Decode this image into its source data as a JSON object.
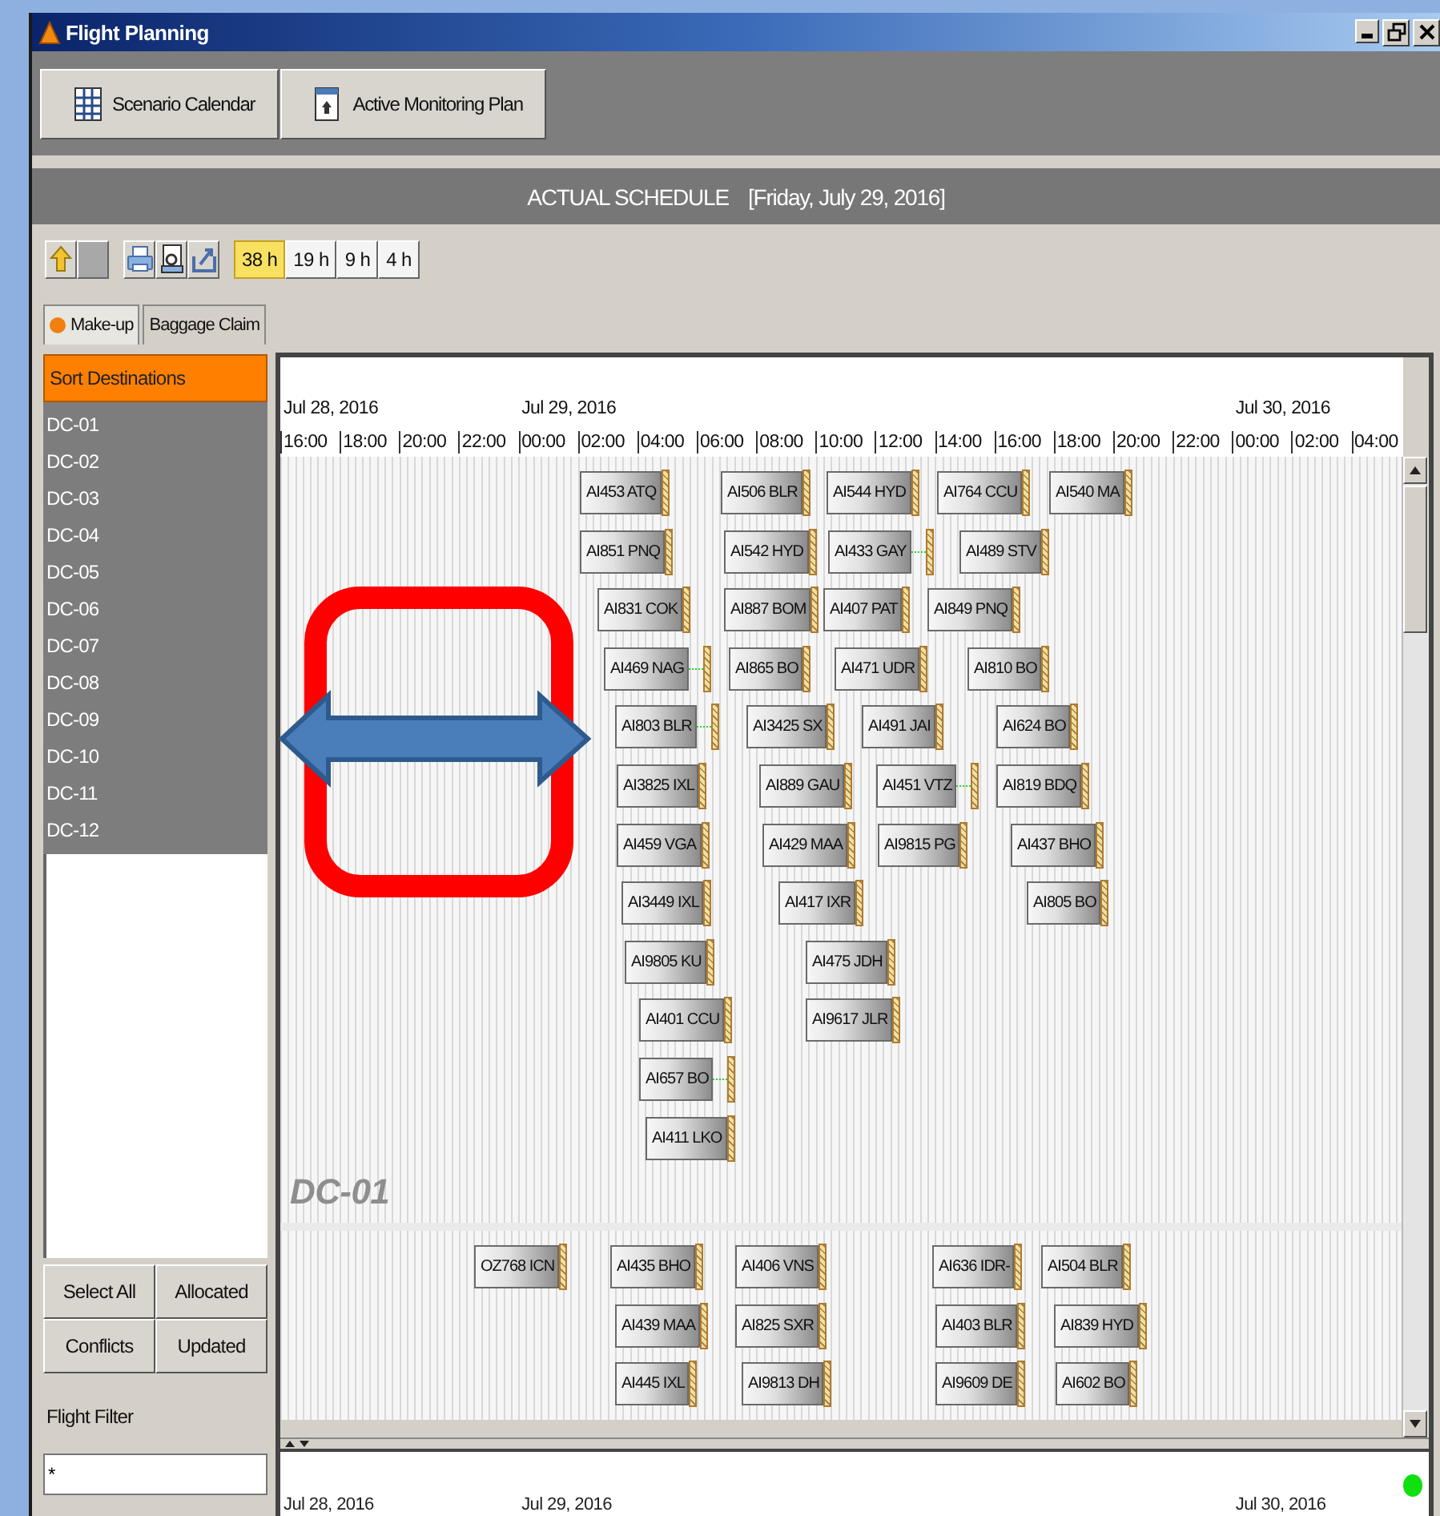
{
  "window": {
    "title": "Flight Planning"
  },
  "toolbar": [
    {
      "label": "Scenario Calendar",
      "kind": "calendar"
    },
    {
      "label": "Active Monitoring Plan",
      "kind": "plan"
    }
  ],
  "schedule": {
    "title": "ACTUAL SCHEDULE",
    "date": "[Friday, July 29, 2016]"
  },
  "tools": [
    {
      "kind": "up",
      "disabled": false
    },
    {
      "kind": "blank",
      "disabled": true
    },
    {
      "kind": "print",
      "disabled": false
    },
    {
      "kind": "preview",
      "disabled": false
    },
    {
      "kind": "export",
      "disabled": false
    }
  ],
  "zoom_buttons": [
    {
      "label": "38 h",
      "selected": true
    },
    {
      "label": "19 h",
      "selected": false
    },
    {
      "label": "9 h",
      "selected": false
    },
    {
      "label": "4 h",
      "selected": false
    }
  ],
  "side_tabs": [
    {
      "label": "Make-up",
      "selected": true
    },
    {
      "label": "Baggage Claim",
      "selected": false
    }
  ],
  "sort_destinations": {
    "title": "Sort Destinations",
    "items": [
      "DC-01",
      "DC-02",
      "DC-03",
      "DC-04",
      "DC-05",
      "DC-06",
      "DC-07",
      "DC-08",
      "DC-09",
      "DC-10",
      "DC-11",
      "DC-12"
    ]
  },
  "filter_buttons": [
    "Select All",
    "Allocated",
    "Conflicts",
    "Updated"
  ],
  "flight_filter": {
    "label": "Flight Filter",
    "value": "*"
  },
  "timeline": {
    "dates": [
      "Jul 28, 2016",
      "Jul 29, 2016",
      "Jul 30, 2016"
    ],
    "hours": [
      "16:00",
      "18:00",
      "20:00",
      "22:00",
      "00:00",
      "02:00",
      "04:00",
      "06:00",
      "08:00",
      "10:00",
      "12:00",
      "14:00",
      "16:00",
      "18:00",
      "20:00",
      "22:00",
      "00:00",
      "02:00",
      "04:00"
    ]
  },
  "sections": [
    {
      "label": "DC-01",
      "flights": [
        {
          "flight": "AI453 ATQ",
          "linked": false
        },
        {
          "flight": "AI506 BLR",
          "linked": false
        },
        {
          "flight": "AI544 HYD",
          "linked": false
        },
        {
          "flight": "AI764 CCU",
          "linked": false
        },
        {
          "flight": "AI540 MA",
          "linked": false
        },
        {
          "flight": "AI851 PNQ",
          "linked": false
        },
        {
          "flight": "AI542 HYD",
          "linked": false
        },
        {
          "flight": "AI433 GAY",
          "linked": true
        },
        {
          "flight": "AI489 STV",
          "linked": false
        },
        {
          "flight": "AI831 COK",
          "linked": false
        },
        {
          "flight": "AI887 BOM",
          "linked": false
        },
        {
          "flight": "AI407 PAT",
          "linked": false
        },
        {
          "flight": "AI849 PNQ",
          "linked": false
        },
        {
          "flight": "AI469 NAG",
          "linked": true
        },
        {
          "flight": "AI865 BO",
          "linked": false
        },
        {
          "flight": "AI471 UDR",
          "linked": false
        },
        {
          "flight": "AI810 BO",
          "linked": false
        },
        {
          "flight": "AI803 BLR",
          "linked": true
        },
        {
          "flight": "AI3425 SX",
          "linked": false
        },
        {
          "flight": "AI491 JAI",
          "linked": false
        },
        {
          "flight": "AI624 BO",
          "linked": false
        },
        {
          "flight": "AI3825 IXL",
          "linked": false
        },
        {
          "flight": "AI889 GAU",
          "linked": false
        },
        {
          "flight": "AI451 VTZ",
          "linked": true
        },
        {
          "flight": "AI819 BDQ",
          "linked": false
        },
        {
          "flight": "AI459 VGA",
          "linked": false
        },
        {
          "flight": "AI429 MAA",
          "linked": false
        },
        {
          "flight": "AI9815 PG",
          "linked": false
        },
        {
          "flight": "AI437 BHO",
          "linked": false
        },
        {
          "flight": "AI3449 IXL",
          "linked": false
        },
        {
          "flight": "AI417 IXR",
          "linked": false
        },
        {
          "flight": "AI805 BO",
          "linked": false
        },
        {
          "flight": "AI9805 KU",
          "linked": false
        },
        {
          "flight": "AI475 JDH",
          "linked": false
        },
        {
          "flight": "AI401 CCU",
          "linked": false
        },
        {
          "flight": "AI9617 JLR",
          "linked": false
        },
        {
          "flight": "AI657 BO",
          "linked": true
        },
        {
          "flight": "AI411 LKO",
          "linked": false
        }
      ]
    },
    {
      "flights": [
        {
          "flight": "OZ768 ICN",
          "linked": false
        },
        {
          "flight": "AI435 BHO",
          "linked": false
        },
        {
          "flight": "AI406 VNS",
          "linked": false
        },
        {
          "flight": "AI636 IDR-",
          "linked": false
        },
        {
          "flight": "AI504 BLR",
          "linked": false
        },
        {
          "flight": "AI439 MAA",
          "linked": false
        },
        {
          "flight": "AI825 SXR",
          "linked": false
        },
        {
          "flight": "AI403 BLR",
          "linked": false
        },
        {
          "flight": "AI839 HYD",
          "linked": false
        },
        {
          "flight": "AI445 IXL",
          "linked": false
        },
        {
          "flight": "AI9813 DH",
          "linked": false
        },
        {
          "flight": "AI9609 DE",
          "linked": false
        },
        {
          "flight": "AI602 BO",
          "linked": false
        }
      ]
    }
  ],
  "overview": {
    "dates": [
      "Jul 28, 2016",
      "Jul 29, 2016",
      "Jul 30, 2016"
    ]
  }
}
